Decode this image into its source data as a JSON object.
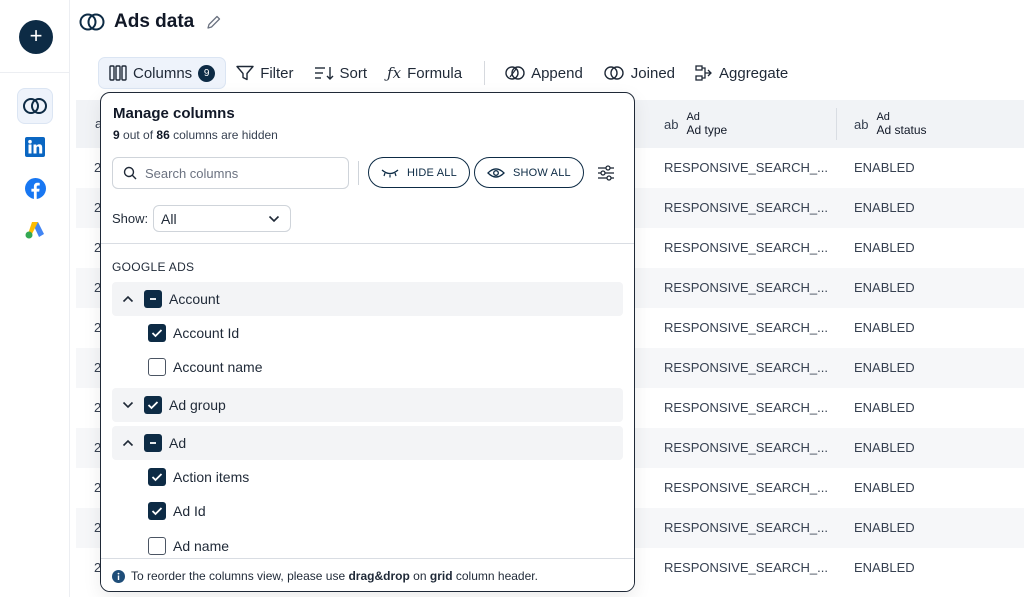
{
  "app": {
    "title": "Ads data",
    "sources": [
      "linkedin-icon",
      "facebook-icon",
      "google-ads-icon"
    ]
  },
  "toolbar": {
    "columns_label": "Columns",
    "columns_badge": "9",
    "filter_label": "Filter",
    "sort_label": "Sort",
    "formula_label": "Formula",
    "append_label": "Append",
    "joined_label": "Joined",
    "aggregate_label": "Aggregate"
  },
  "grid": {
    "columns": [
      {
        "type": "ab",
        "group": "Ad",
        "name": "Ad type"
      },
      {
        "type": "ab",
        "group": "Ad",
        "name": "Ad status"
      }
    ],
    "row_prefix": "2",
    "rows": [
      [
        "RESPONSIVE_SEARCH_...",
        "ENABLED"
      ],
      [
        "RESPONSIVE_SEARCH_...",
        "ENABLED"
      ],
      [
        "RESPONSIVE_SEARCH_...",
        "ENABLED"
      ],
      [
        "RESPONSIVE_SEARCH_...",
        "ENABLED"
      ],
      [
        "RESPONSIVE_SEARCH_...",
        "ENABLED"
      ],
      [
        "RESPONSIVE_SEARCH_...",
        "ENABLED"
      ],
      [
        "RESPONSIVE_SEARCH_...",
        "ENABLED"
      ],
      [
        "RESPONSIVE_SEARCH_...",
        "ENABLED"
      ],
      [
        "RESPONSIVE_SEARCH_...",
        "ENABLED"
      ],
      [
        "RESPONSIVE_SEARCH_...",
        "ENABLED"
      ],
      [
        "RESPONSIVE_SEARCH_...",
        "ENABLED"
      ]
    ]
  },
  "panel": {
    "title": "Manage columns",
    "hidden_count": "9",
    "hidden_mid": "out of",
    "total_count": "86",
    "hidden_tail": "columns are hidden",
    "search_placeholder": "Search columns",
    "hide_all_label": "HIDE ALL",
    "show_all_label": "SHOW ALL",
    "show_label": "Show:",
    "show_value": "All",
    "section_label": "GOOGLE ADS",
    "groups": [
      {
        "label": "Account",
        "expanded": true,
        "state": "partial",
        "children": [
          {
            "label": "Account Id",
            "checked": true
          },
          {
            "label": "Account name",
            "checked": false
          }
        ]
      },
      {
        "label": "Ad group",
        "expanded": false,
        "state": "checked",
        "children": []
      },
      {
        "label": "Ad",
        "expanded": true,
        "state": "partial",
        "children": [
          {
            "label": "Action items",
            "checked": true
          },
          {
            "label": "Ad Id",
            "checked": true
          },
          {
            "label": "Ad name",
            "checked": false
          }
        ]
      }
    ],
    "footer": {
      "pre": "To reorder the columns view, please use",
      "bold1": "drag&drop",
      "mid": "on",
      "bold2": "grid",
      "post": "column header."
    }
  },
  "colors": {
    "primary": "#0d2b45",
    "linkedin": "#0a66c2",
    "facebook": "#1877f2"
  }
}
